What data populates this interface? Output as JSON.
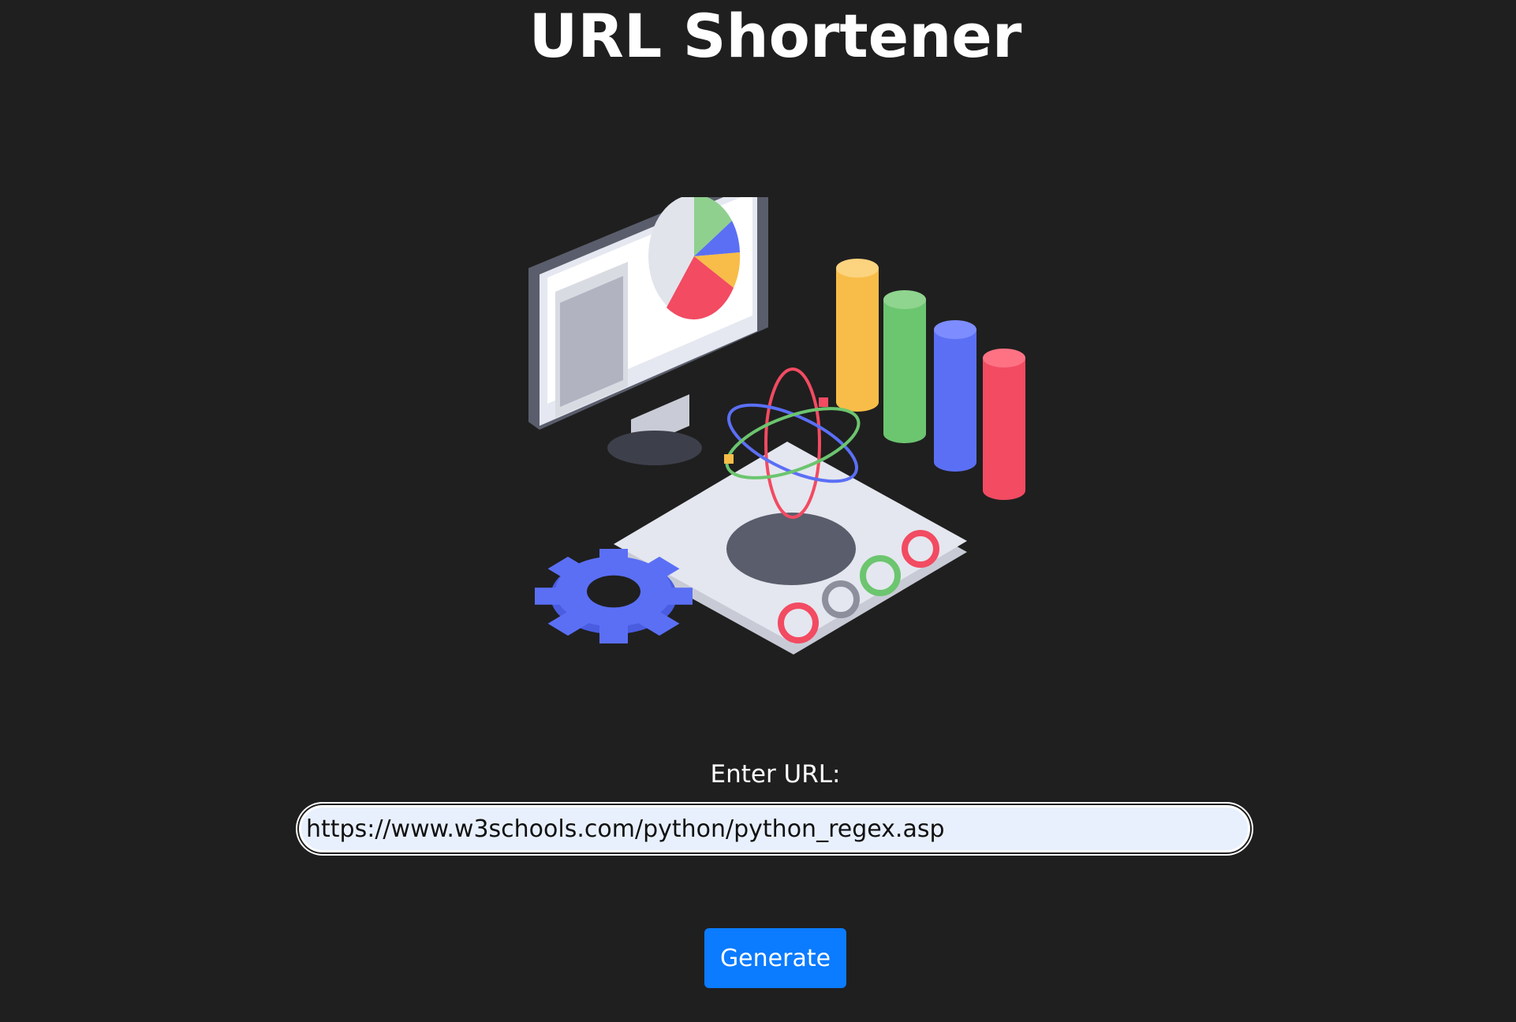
{
  "header": {
    "title": "URL Shortener"
  },
  "form": {
    "label": "Enter URL:",
    "url_value": "https://www.w3schools.com/python/python_regex.asp",
    "button_label": "Generate"
  },
  "colors": {
    "background": "#1f1f1f",
    "button": "#0b7bff",
    "input_background": "#e8f0fe",
    "chart_yellow": "#f8bd48",
    "chart_green": "#6cc56f",
    "chart_blue": "#5b6ff5",
    "chart_red": "#f24b62"
  },
  "illustration": {
    "icon": "analytics-computer-illustration"
  }
}
